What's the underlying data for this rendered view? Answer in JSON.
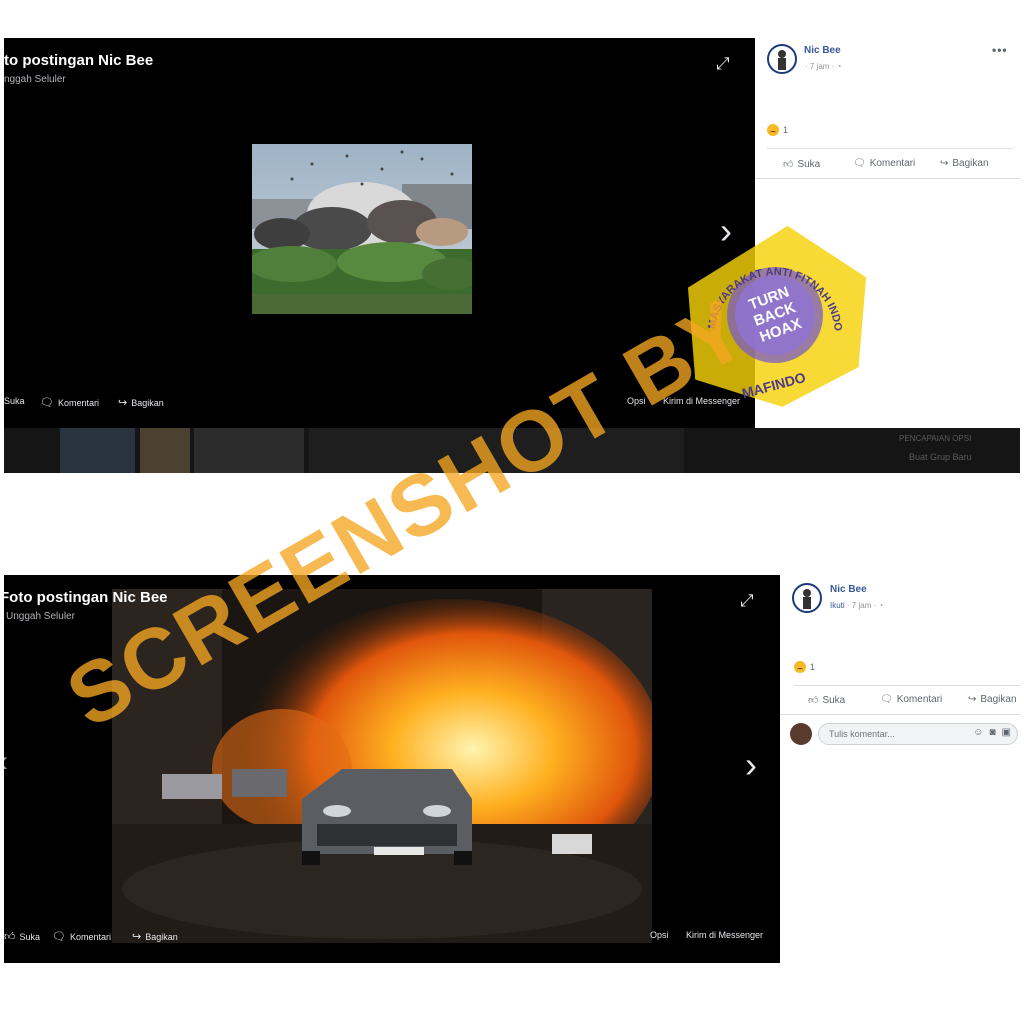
{
  "posts": [
    {
      "photo_title": "to postingan Nic Bee",
      "photo_subtitle": "nggah Seluler",
      "viewer_actions": {
        "like": "Suka",
        "comment": "Komentari",
        "share": "Bagikan"
      },
      "viewer_right": {
        "options": "Opsi",
        "messenger": "Kirim di Messenger"
      },
      "author": "Nic Bee",
      "meta": "· 7 jam ·",
      "reaction_count": "1",
      "actions": {
        "like": "Suka",
        "comment": "Komentari",
        "share": "Bagikan"
      },
      "sidebar_hint": {
        "line1": "PENCAPAIAN OPSI",
        "line2": "Buat Grup Baru"
      }
    },
    {
      "photo_title": "Foto postingan Nic Bee",
      "photo_subtitle": "Unggah Seluler",
      "viewer_actions": {
        "like": "Suka",
        "comment": "Komentari",
        "share": "Bagikan"
      },
      "viewer_right": {
        "options": "Opsi",
        "messenger": "Kirim di Messenger"
      },
      "author": "Nic Bee",
      "follow": "Ikuti",
      "meta": "· 7 jam ·",
      "reaction_count": "1",
      "actions": {
        "like": "Suka",
        "comment": "Komentari",
        "share": "Bagikan"
      },
      "comment_placeholder": "Tulis komentar..."
    }
  ],
  "watermark": {
    "text": "SCREENSHOT BY"
  },
  "badge": {
    "ring_text": "MASYARAKAT ANTI FITNAH INDONESIA",
    "center_lines": [
      "TURN",
      "BACK",
      "HOAX"
    ],
    "bottom_text": "MAFINDO"
  },
  "icons": {
    "expand": "expand-icon",
    "next": "chevron-right-icon",
    "prev": "chevron-left-icon",
    "like": "thumbs-up-icon",
    "comment": "speech-bubble-icon",
    "share": "share-arrow-icon",
    "globe": "globe-icon",
    "more": "more-dots-icon"
  },
  "colors": {
    "viewer_bg": "#000000",
    "link_blue": "#385898",
    "watermark_orange": "#f5a623",
    "badge_yellow": "#f5d20a",
    "badge_purple": "#7b5cc4"
  }
}
